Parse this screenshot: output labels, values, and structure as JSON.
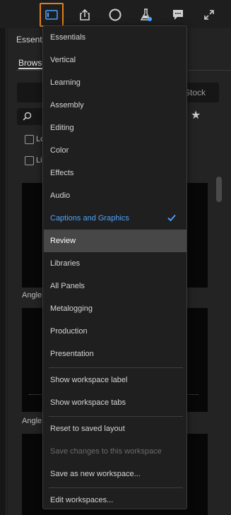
{
  "toolbar": {
    "icons": [
      "workspaces-icon",
      "export-icon",
      "record-icon",
      "beta-flask-icon",
      "feedback-icon",
      "fullscreen-icon"
    ],
    "accent_color": "#e17f1f"
  },
  "panel": {
    "title": "Essenti",
    "tab": "Browse",
    "stock_label": "Stock",
    "checkboxes": [
      "Lo",
      "Li"
    ],
    "thumb_labels": [
      "Angle",
      "Angle"
    ]
  },
  "menu": {
    "items": [
      {
        "label": "Essentials"
      },
      {
        "label": "Vertical"
      },
      {
        "label": "Learning"
      },
      {
        "label": "Assembly"
      },
      {
        "label": "Editing"
      },
      {
        "label": "Color"
      },
      {
        "label": "Effects"
      },
      {
        "label": "Audio"
      },
      {
        "label": "Captions and Graphics",
        "state": "selected"
      },
      {
        "label": "Review",
        "state": "hover"
      },
      {
        "label": "Libraries"
      },
      {
        "label": "All Panels"
      },
      {
        "label": "Metalogging"
      },
      {
        "label": "Production"
      },
      {
        "label": "Presentation"
      }
    ],
    "options": [
      {
        "label": "Show workspace label"
      },
      {
        "label": "Show workspace tabs"
      }
    ],
    "actions": [
      {
        "label": "Reset to saved layout"
      },
      {
        "label": "Save changes to this workspace",
        "state": "disabled"
      },
      {
        "label": "Save as new workspace..."
      }
    ],
    "edit": {
      "label": "Edit workspaces..."
    },
    "selected_color": "#4da3ff",
    "hover_bg": "#474747"
  }
}
